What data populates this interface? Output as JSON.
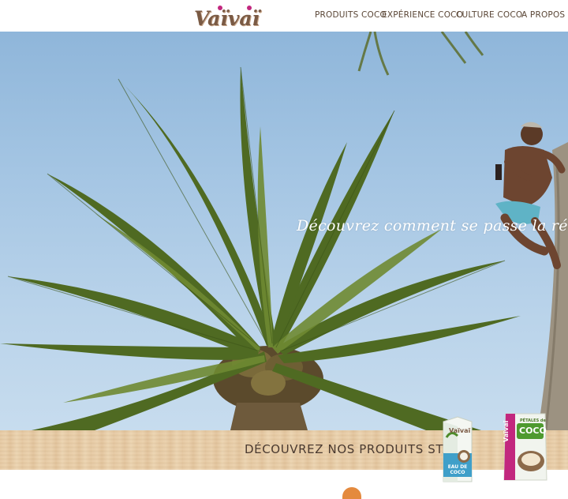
{
  "brand": {
    "logo_text": "Vaïvaï"
  },
  "nav": {
    "items": [
      {
        "label": "PRODUITS COCO"
      },
      {
        "label": "EXPÉRIENCE COCO"
      },
      {
        "label": "CULTURE COCO"
      },
      {
        "label": "A PROPOS"
      }
    ]
  },
  "hero": {
    "caption": "Découvrez comment se passe la récolte des no"
  },
  "products_banner": {
    "title": "DÉCOUVREZ NOS PRODUITS STAR :"
  },
  "products": [
    {
      "brand": "Vaïvaï",
      "name": "EAU DE COCO"
    },
    {
      "brand": "Vaïvaï",
      "name_small": "PÉTALES de",
      "name": "COCO"
    }
  ],
  "colors": {
    "brand_brown": "#7a5a44",
    "brand_pink": "#c2277e",
    "nav_text": "#5a4636",
    "sky": "#a4c5e3",
    "wood": "#e6c9a2"
  },
  "icons": [
    "coconut-icon"
  ]
}
